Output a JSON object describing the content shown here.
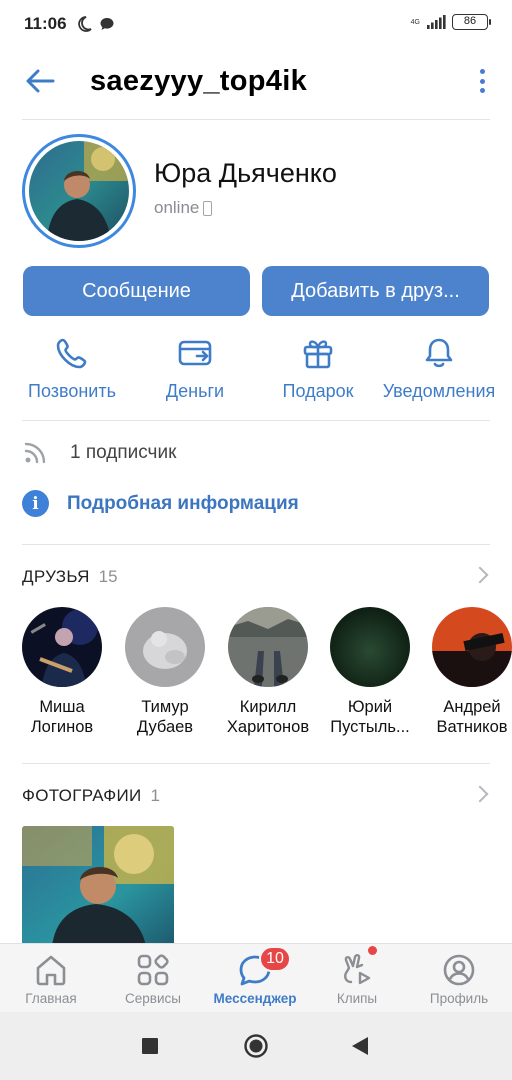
{
  "status_bar": {
    "time": "11:06",
    "network": "4G",
    "battery": "86"
  },
  "header": {
    "title": "saezyyy_top4ik"
  },
  "profile": {
    "name": "Юра Дьяченко",
    "status": "online"
  },
  "buttons": {
    "message": "Сообщение",
    "add_friend": "Добавить в друз..."
  },
  "actions": [
    {
      "label": "Позвонить",
      "icon": "phone-icon"
    },
    {
      "label": "Деньги",
      "icon": "wallet-icon"
    },
    {
      "label": "Подарок",
      "icon": "gift-icon"
    },
    {
      "label": "Уведомления",
      "icon": "bell-icon"
    }
  ],
  "subscribers": {
    "text": "1 подписчик"
  },
  "info": {
    "text": "Подробная информация"
  },
  "friends": {
    "title": "ДРУЗЬЯ",
    "count": "15",
    "items": [
      {
        "first": "Миша",
        "last": "Логинов"
      },
      {
        "first": "Тимур",
        "last": "Дубаев"
      },
      {
        "first": "Кирилл",
        "last": "Харитонов"
      },
      {
        "first": "Юрий",
        "last": "Пустыль..."
      },
      {
        "first": "Андрей",
        "last": "Ватников"
      }
    ]
  },
  "photos": {
    "title": "ФОТОГРАФИИ",
    "count": "1"
  },
  "tabbar": {
    "items": [
      {
        "label": "Главная",
        "icon": "home-icon"
      },
      {
        "label": "Сервисы",
        "icon": "services-icon"
      },
      {
        "label": "Мессенджер",
        "icon": "messenger-icon",
        "badge": "10"
      },
      {
        "label": "Клипы",
        "icon": "clips-icon"
      },
      {
        "label": "Профиль",
        "icon": "profile-icon"
      }
    ]
  },
  "colors": {
    "accent": "#4d83cd",
    "link": "#3f7cc8",
    "badge": "#e64646"
  }
}
